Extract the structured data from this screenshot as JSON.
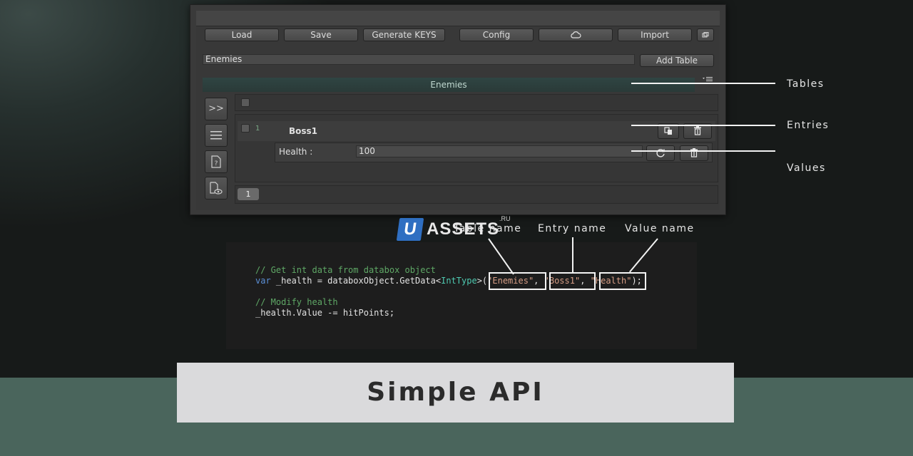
{
  "toolbar": {
    "load": "Load",
    "save": "Save",
    "generate_keys": "Generate KEYS",
    "config": "Config",
    "import": "Import"
  },
  "table_select": {
    "value": "Enemies",
    "add_table": "Add Table"
  },
  "tables_bar": {
    "label": "Enemies"
  },
  "sidebar": {
    "expand_label": ">>"
  },
  "entry": {
    "index": "1",
    "name": "Boss1",
    "value_label": "Health :",
    "value": "100"
  },
  "pagination": {
    "page": "1"
  },
  "annotations": {
    "tables": "Tables",
    "entries": "Entries",
    "values": "Values",
    "table_name": "Table name",
    "entry_name": "Entry name",
    "value_name": "Value name"
  },
  "code": {
    "comment1": "// Get int data from databox object",
    "line2_kw": "var",
    "line2_a": " _health = databoxObject.GetData<",
    "line2_type": "IntType",
    "line2_b": ">(",
    "str_table": "\"Enemies\"",
    "sep1": ", ",
    "str_entry": "\"Boss1\"",
    "sep2": ", ",
    "str_value": "\"Health\"",
    "line2_end": ");",
    "comment2": "// Modify health",
    "line4": "_health.Value -= hitPoints;"
  },
  "logo": {
    "mark": "U",
    "text": "ASSETS",
    "suffix": ".RU"
  },
  "banner": {
    "title": "Simple API"
  },
  "colors": {
    "bottom_band": "#4a655c",
    "banner_bg": "#dadadc",
    "tables_bar": "#2f4543",
    "logo_blue": "#2f6fc2"
  }
}
